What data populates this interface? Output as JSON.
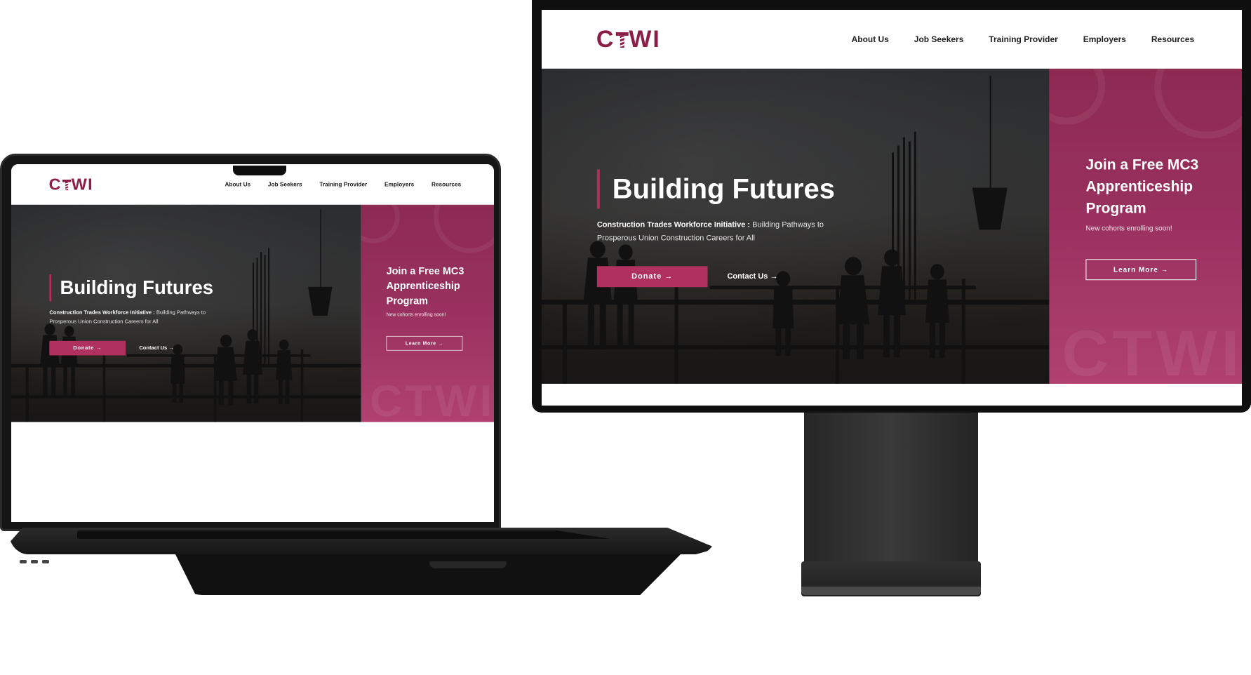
{
  "brand": {
    "logo_left": "C",
    "logo_right": "WI",
    "accent": "#8b1e47",
    "button": "#b0315e",
    "panel": "#9a3160"
  },
  "nav": {
    "items": [
      "About Us",
      "Job Seekers",
      "Training Provider",
      "Employers",
      "Resources"
    ]
  },
  "hero": {
    "title": "Building Futures",
    "org_name": "Construction Trades Workforce Initiative :",
    "tagline": " Building Pathways to Prosperous Union Construction Careers for All",
    "donate": "Donate →",
    "contact": "Contact Us →"
  },
  "promo": {
    "title": "Join a Free MC3 Apprenticeship Program",
    "subtitle": "New cohorts enrolling soon!",
    "button": "Learn More →",
    "watermark": "CTWI"
  }
}
